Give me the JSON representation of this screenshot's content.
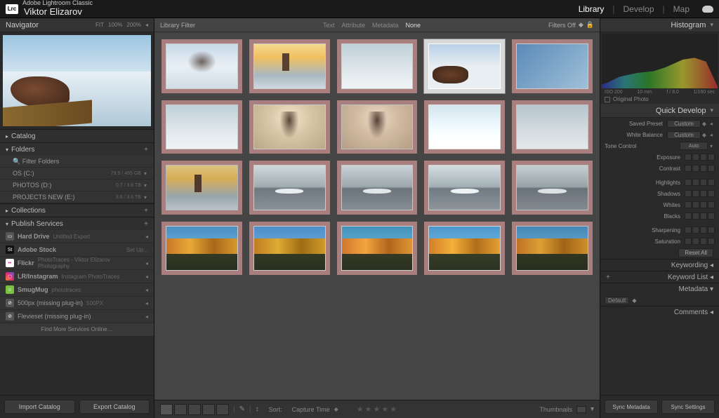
{
  "app": {
    "name": "Adobe Lightroom Classic",
    "user": "Viktor Elizarov",
    "logo": "Lrc"
  },
  "modules": {
    "library": "Library",
    "develop": "Develop",
    "map": "Map"
  },
  "navigator": {
    "title": "Navigator",
    "fit": "FIT",
    "z100": "100%",
    "z200": "200%"
  },
  "catalog": {
    "title": "Catalog"
  },
  "folders": {
    "title": "Folders",
    "filter": "Filter Folders",
    "drives": {
      "c": {
        "label": "OS (C:)",
        "meta": "79.9 / 465 GB"
      },
      "d": {
        "label": "PHOTOS (D:)",
        "meta": "0.7 / 3.6 TB"
      },
      "e": {
        "label": "PROJECTS NEW (E:)",
        "meta": "3.6 / 3.6 TB"
      }
    }
  },
  "collections": {
    "title": "Collections"
  },
  "publish": {
    "title": "Publish Services",
    "hd": {
      "name": "Hard Drive",
      "sub": "Untitled Export"
    },
    "stock": {
      "name": "Adobe Stock",
      "sub": "Set Up..."
    },
    "flickr": {
      "name": "Flickr",
      "sub": "PhotoTraces - Viktor Elizarov Photography"
    },
    "insta": {
      "name": "LR/Instagram",
      "sub": "Instagram PhotoTraces"
    },
    "smug": {
      "name": "SmugMug",
      "sub": "phototraces"
    },
    "px500": {
      "name": "500px (missing plug-in)",
      "sub": "500PX"
    },
    "fv": {
      "name": "Flevieset (missing plug-in)",
      "sub": ""
    },
    "more": "Find More Services Online…"
  },
  "left_buttons": {
    "import": "Import Catalog",
    "export": "Export Catalog"
  },
  "filter": {
    "title": "Library Filter",
    "text": "Text",
    "attribute": "Attribute",
    "metadata": "Metadata",
    "none": "None",
    "off": "Filters Off"
  },
  "toolbar": {
    "sort": "Sort:",
    "sort_val": "Capture Time",
    "thumbnails": "Thumbnails"
  },
  "histogram": {
    "title": "Histogram",
    "iso": "ISO 200",
    "focal": "10 mm",
    "aperture": "f / 8.0",
    "shutter": "1/160 sec",
    "original": "Original Photo"
  },
  "quickdev": {
    "title": "Quick Develop",
    "preset_l": "Saved Preset",
    "preset_v": "Custom",
    "wb_l": "White Balance",
    "wb_v": "Custom",
    "tone_l": "Tone Control",
    "auto": "Auto",
    "exposure": "Exposure",
    "contrast": "Contrast",
    "highlights": "Highlights",
    "shadows": "Shadows",
    "whites": "Whites",
    "blacks": "Blacks",
    "sharpening": "Sharpening",
    "saturation": "Saturation",
    "reset": "Reset All"
  },
  "right_sections": {
    "keywording": "Keywording",
    "keywordlist": "Keyword List",
    "metadata": "Metadata",
    "metadata_mode": "Default",
    "comments": "Comments"
  },
  "right_buttons": {
    "syncm": "Sync Metadata",
    "syncs": "Sync Settings"
  }
}
